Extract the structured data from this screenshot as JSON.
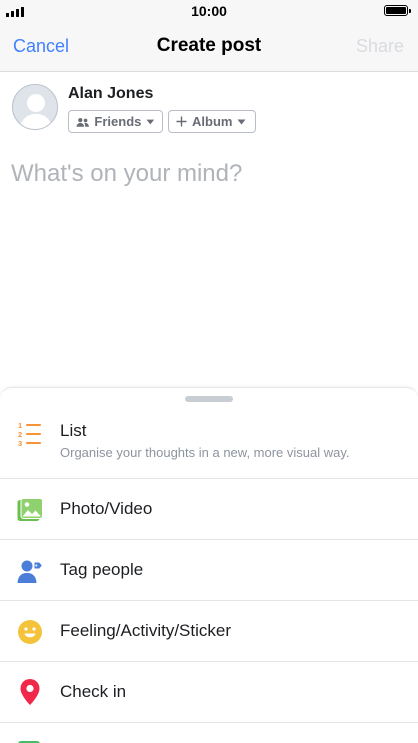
{
  "status_bar": {
    "time": "10:00"
  },
  "nav": {
    "cancel_label": "Cancel",
    "title": "Create post",
    "share_label": "Share"
  },
  "composer": {
    "user_name": "Alan Jones",
    "audience_label": "Friends",
    "album_label": "Album",
    "placeholder": "What's on your mind?",
    "value": ""
  },
  "options": {
    "list": {
      "label": "List",
      "description": "Organise your thoughts in a new, more visual way.",
      "icon": "numbered-list-icon",
      "color": "#f7923b"
    },
    "photo_video": {
      "label": "Photo/Video",
      "icon": "photo-icon",
      "color": "#6bbf4e"
    },
    "tag_people": {
      "label": "Tag people",
      "icon": "tag-people-icon",
      "color": "#4a7ed9"
    },
    "feeling": {
      "label": "Feeling/Activity/Sticker",
      "icon": "smiley-icon",
      "color": "#f5c33b"
    },
    "check_in": {
      "label": "Check in",
      "icon": "location-pin-icon",
      "color": "#f0284a"
    },
    "next_item_icon_color": "#45bd62"
  },
  "colors": {
    "accent": "#4080ff",
    "disabled": "#d9dbe0",
    "separator": "#e2e4e8"
  }
}
